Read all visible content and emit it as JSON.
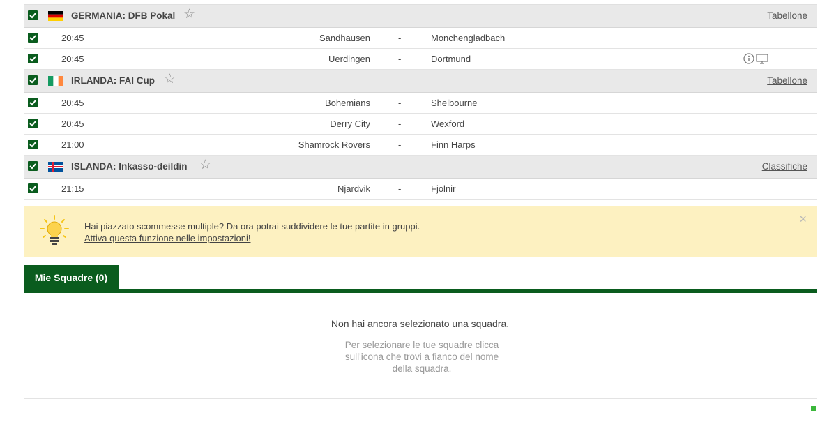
{
  "leagues": [
    {
      "name": "GERMANIA: DFB Pokal",
      "link": "Tabellone",
      "flag": "germany",
      "matches": [
        {
          "time": "20:45",
          "home": "Sandhausen",
          "sep": "-",
          "away": "Monchengladbach",
          "icons": []
        },
        {
          "time": "20:45",
          "home": "Uerdingen",
          "sep": "-",
          "away": "Dortmund",
          "icons": [
            "info-icon",
            "tv-icon"
          ]
        }
      ]
    },
    {
      "name": "IRLANDA: FAI Cup",
      "link": "Tabellone",
      "flag": "ireland",
      "matches": [
        {
          "time": "20:45",
          "home": "Bohemians",
          "sep": "-",
          "away": "Shelbourne",
          "icons": []
        },
        {
          "time": "20:45",
          "home": "Derry City",
          "sep": "-",
          "away": "Wexford",
          "icons": []
        },
        {
          "time": "21:00",
          "home": "Shamrock Rovers",
          "sep": "-",
          "away": "Finn Harps",
          "icons": []
        }
      ]
    },
    {
      "name": "ISLANDA: Inkasso-deildin",
      "link": "Classifiche",
      "flag": "iceland",
      "matches": [
        {
          "time": "21:15",
          "home": "Njardvik",
          "sep": "-",
          "away": "Fjolnir",
          "icons": []
        }
      ]
    }
  ],
  "banner": {
    "text": "Hai piazzato scommesse multiple? Da ora potrai suddividere le tue partite in gruppi.",
    "link": "Attiva questa funzione nelle impostazioni!",
    "close": "×"
  },
  "tab": {
    "label": "Mie Squadre (0)"
  },
  "empty": {
    "title": "Non hai ancora selezionato una squadra.",
    "hint": "Per selezionare le tue squadre clicca sull'icona che trovi a fianco del nome della squadra."
  },
  "star_glyph": "☆",
  "colors": {
    "accent": "#0a5c1e",
    "banner_bg": "#fdf1c1",
    "header_bg": "#e9e9e9"
  }
}
